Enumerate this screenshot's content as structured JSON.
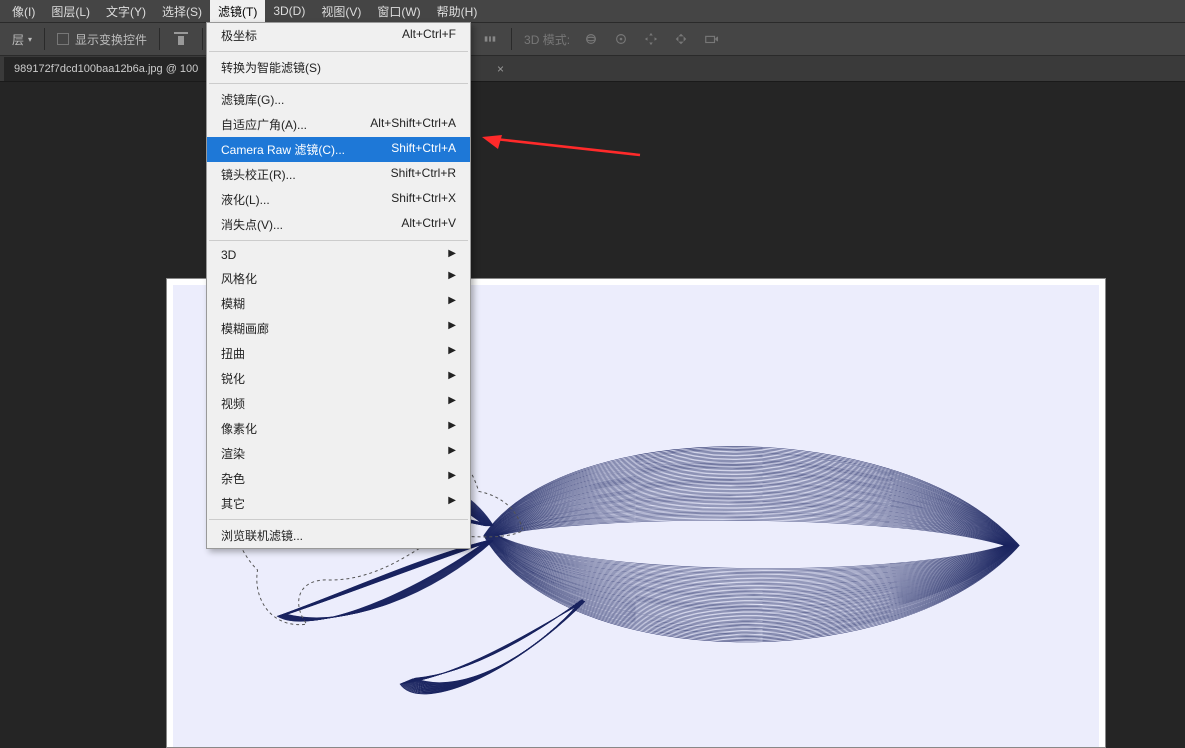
{
  "menubar": {
    "items": [
      {
        "label": "像(I)"
      },
      {
        "label": "图层(L)"
      },
      {
        "label": "文字(Y)"
      },
      {
        "label": "选择(S)"
      },
      {
        "label": "滤镜(T)"
      },
      {
        "label": "3D(D)"
      },
      {
        "label": "视图(V)"
      },
      {
        "label": "窗口(W)"
      },
      {
        "label": "帮助(H)"
      }
    ]
  },
  "toolbar": {
    "layer_label": "层",
    "transform_controls": "显示变换控件",
    "mode_3d": "3D 模式:"
  },
  "tabbar": {
    "doc_name": "989172f7dcd100baa12b6a.jpg @ 100"
  },
  "filter_menu": {
    "items": [
      {
        "label": "极坐标",
        "shortcut": "Alt+Ctrl+F",
        "type": "item"
      },
      {
        "type": "sep"
      },
      {
        "label": "转换为智能滤镜(S)",
        "shortcut": "",
        "type": "item"
      },
      {
        "type": "sep"
      },
      {
        "label": "滤镜库(G)...",
        "shortcut": "",
        "type": "item"
      },
      {
        "label": "自适应广角(A)...",
        "shortcut": "Alt+Shift+Ctrl+A",
        "type": "item"
      },
      {
        "label": "Camera Raw 滤镜(C)...",
        "shortcut": "Shift+Ctrl+A",
        "type": "item",
        "highlighted": true
      },
      {
        "label": "镜头校正(R)...",
        "shortcut": "Shift+Ctrl+R",
        "type": "item"
      },
      {
        "label": "液化(L)...",
        "shortcut": "Shift+Ctrl+X",
        "type": "item"
      },
      {
        "label": "消失点(V)...",
        "shortcut": "Alt+Ctrl+V",
        "type": "item"
      },
      {
        "type": "sep"
      },
      {
        "label": "3D",
        "shortcut": "",
        "type": "submenu"
      },
      {
        "label": "风格化",
        "shortcut": "",
        "type": "submenu"
      },
      {
        "label": "模糊",
        "shortcut": "",
        "type": "submenu"
      },
      {
        "label": "模糊画廊",
        "shortcut": "",
        "type": "submenu"
      },
      {
        "label": "扭曲",
        "shortcut": "",
        "type": "submenu"
      },
      {
        "label": "锐化",
        "shortcut": "",
        "type": "submenu"
      },
      {
        "label": "视频",
        "shortcut": "",
        "type": "submenu"
      },
      {
        "label": "像素化",
        "shortcut": "",
        "type": "submenu"
      },
      {
        "label": "渲染",
        "shortcut": "",
        "type": "submenu"
      },
      {
        "label": "杂色",
        "shortcut": "",
        "type": "submenu"
      },
      {
        "label": "其它",
        "shortcut": "",
        "type": "submenu"
      },
      {
        "type": "sep"
      },
      {
        "label": "浏览联机滤镜...",
        "shortcut": "",
        "type": "item"
      }
    ]
  }
}
